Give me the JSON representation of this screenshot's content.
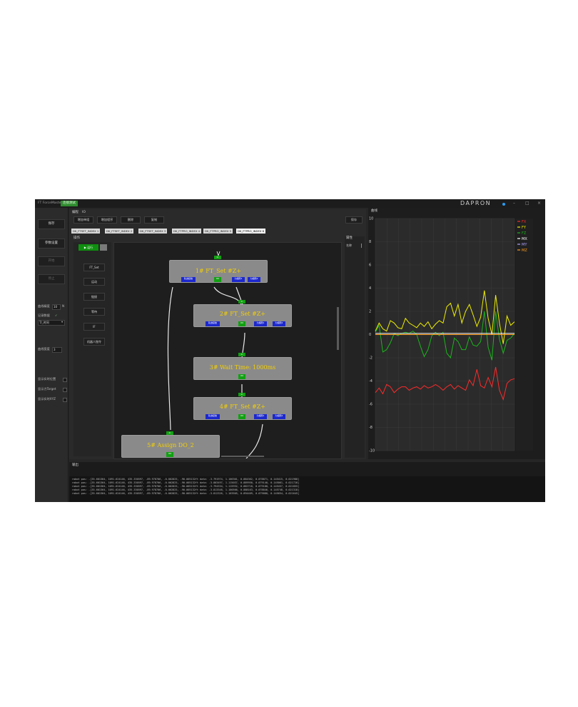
{
  "titlebar": {
    "app_title": "FT ForceMaster",
    "test_button": "连接测试",
    "logo": "DAPRON",
    "min": "–",
    "max": "□",
    "close": "×"
  },
  "sidebar": {
    "btn_save": "保存",
    "btn_params": "参数设置",
    "btn_start": "开始",
    "btn_stop": "停止",
    "curve_precision_label": "曲线精度",
    "curve_precision_value": "10",
    "curve_precision_unit": "N",
    "record_label": "记录数据",
    "record_check": "✓",
    "record_mode": "T/_时间",
    "curve_width_label": "曲线宽度",
    "curve_width_value": "3",
    "opt1": "显示实时位置",
    "opt2": "显示力Target",
    "opt3": "显示实时XYZ"
  },
  "editor": {
    "header": "编程",
    "header_badge": "IO",
    "toolbar": [
      "增加单组",
      "增加程序",
      "删除",
      "复制"
    ],
    "save_btn": "保存",
    "tabs": [
      "DK_FTSET_INDEX 1",
      "DK_FTSET_INDEX 2",
      "DK_FTSET_INDEX 3",
      "DK_FTPRO_INDEX 4",
      "DK_FTPRO_INDEX 5",
      "DK_FTPRO_INDEX 6"
    ],
    "active_tab": 4,
    "canvas_label": "操作",
    "run_btn": "▶ 运行",
    "tools": [
      "FT_Set",
      "运动",
      "链接",
      "等待",
      "IF",
      "机器人指令"
    ],
    "props_label": "属性",
    "props_name": "名称"
  },
  "nodes": [
    {
      "title": "1# FT_Set #Z+",
      "in": "In",
      "outs": [
        "轨迹起始",
        "OK",
        "力超限1",
        "力超限2"
      ]
    },
    {
      "title": "2# FT_Set #Z+",
      "in": "In",
      "outs": [
        "轨迹起始",
        "OK",
        "力超限1",
        "力超限2"
      ]
    },
    {
      "title": "3# Wait Time: 1000ms",
      "in": "In",
      "outs": [
        "OK"
      ]
    },
    {
      "title": "4# FT_Set #Z+",
      "in": "In",
      "outs": [
        "轨迹起始",
        "OK",
        "力超限1",
        "力超限2"
      ]
    },
    {
      "title": "5# Assign DO_2",
      "in": "In",
      "outs": [
        "OK"
      ]
    }
  ],
  "chart_panel": {
    "title": "曲线"
  },
  "chart_data": {
    "type": "line",
    "ylim": [
      -10,
      10
    ],
    "yticks": [
      10,
      8,
      6,
      4,
      2,
      0,
      -2,
      -4,
      -6,
      -8,
      -10
    ],
    "grid": true,
    "legend_position": "top-right",
    "legend": [
      {
        "name": "FX",
        "color": "#ff2a2a"
      },
      {
        "name": "FY",
        "color": "#f0f000"
      },
      {
        "name": "FZ",
        "color": "#1bb51b"
      },
      {
        "name": "MX",
        "color": "#ffffff"
      },
      {
        "name": "MY",
        "color": "#b0a0ff"
      },
      {
        "name": "MZ",
        "color": "#ff9a1a"
      }
    ],
    "series": [
      {
        "name": "FY",
        "color": "#f0f000",
        "values": [
          0.3,
          1.0,
          0.5,
          0.3,
          1.2,
          1.0,
          0.6,
          0.5,
          1.4,
          1.0,
          0.8,
          0.6,
          1.0,
          0.7,
          1.1,
          0.5,
          0.9,
          1.2,
          1.0,
          2.4,
          2.7,
          1.6,
          2.6,
          1.0,
          2.0,
          2.6,
          1.7,
          0.7,
          1.5,
          3.8,
          1.4,
          0.0,
          3.4,
          1.0,
          -0.8,
          1.6,
          0.8,
          1.1
        ]
      },
      {
        "name": "FZ",
        "color": "#1bb51b",
        "values": [
          0.2,
          0.8,
          -1.5,
          -1.3,
          -0.7,
          0.1,
          -0.1,
          0.1,
          0.2,
          0.1,
          0.3,
          0.0,
          -1.0,
          -1.9,
          -1.3,
          -0.1,
          0.2,
          -0.1,
          0.2,
          -1.6,
          -2.0,
          -0.3,
          -0.6,
          -1.3,
          -1.3,
          -0.2,
          -0.9,
          -1.0,
          -0.6,
          2.0,
          -1.1,
          -2.2,
          2.0,
          -0.4,
          -1.6,
          -0.5,
          -0.3,
          0.1
        ]
      },
      {
        "name": "FX",
        "color": "#ff2a2a",
        "values": [
          -5.0,
          -4.6,
          -5.1,
          -4.3,
          -4.5,
          -5.0,
          -4.7,
          -4.5,
          -4.5,
          -4.8,
          -4.6,
          -4.5,
          -4.7,
          -4.4,
          -4.6,
          -4.5,
          -4.3,
          -4.5,
          -4.8,
          -4.5,
          -4.3,
          -4.7,
          -4.4,
          -4.6,
          -4.8,
          -3.9,
          -4.4,
          -3.0,
          -4.4,
          -4.6,
          -3.7,
          -4.5,
          -2.8,
          -4.8,
          -5.6,
          -4.2,
          -3.9,
          -3.8
        ]
      },
      {
        "name": "MX",
        "color": "#ffffff",
        "values": [
          0.1,
          0.1,
          0.1,
          0.1,
          0.1,
          0.1,
          0.1,
          0.1,
          0.1,
          0.1,
          0.1,
          0.1,
          0.1,
          0.1,
          0.1,
          0.1,
          0.1,
          0.1,
          0.1,
          0.1,
          0.1,
          0.1,
          0.1,
          0.1,
          0.1,
          0.1,
          0.1,
          0.1,
          0.1,
          0.1,
          0.1,
          0.1,
          0.1,
          0.1,
          0.1,
          0.1,
          0.1,
          0.1
        ]
      },
      {
        "name": "MZ",
        "color": "#ff9a1a",
        "values": [
          0.0,
          0.0,
          0.0,
          0.0,
          0.0,
          0.0,
          0.0,
          0.0,
          0.0,
          0.0,
          0.0,
          0.0,
          0.0,
          0.0,
          0.0,
          0.0,
          0.0,
          0.0,
          0.0,
          0.0,
          0.0,
          0.0,
          0.0,
          0.0,
          0.0,
          0.0,
          0.0,
          0.0,
          0.0,
          0.0,
          0.0,
          0.0,
          0.0,
          0.0,
          0.0,
          0.0,
          0.0,
          0.0
        ]
      }
    ]
  },
  "output": {
    "title": "输出",
    "lines": [
      "robot pos: -[35.601364, 1091.624146, 435.330597, -89.978706, -0.002825, -90.005132ft data: -3.791974, 1.106301, 0.884362, 0.078871, 0.145415, 0.021988]",
      "robot pos: -[35.601364, 1091.624146, 435.330597, -89.978706, -0.002825, -90.005132ft data: -3.803497, 1.115037, 0.889950, 0.079140, 0.145061, 0.021728]",
      "robot pos: -[35.601364, 1091.624146, 435.330597, -89.978706, -0.002825, -90.005132ft data: -3.794334, 1.115932, 0.882718, 0.079188, 0.145457, 0.021855]",
      "robot pos: -[35.601364, 1091.624146, 435.330597, -89.978706, -0.002825, -90.005132ft data: -3.813348, 1.100566, 0.888163, 0.078846, 0.145748, 0.021318]",
      "robot pos: -[35.601364, 1091.624146, 435.330597, -89.978706, -0.002825, -90.005132ft data: -3.812326, 1.103505, 0.894409, 0.079080, 0.145654, 0.021645]"
    ]
  }
}
